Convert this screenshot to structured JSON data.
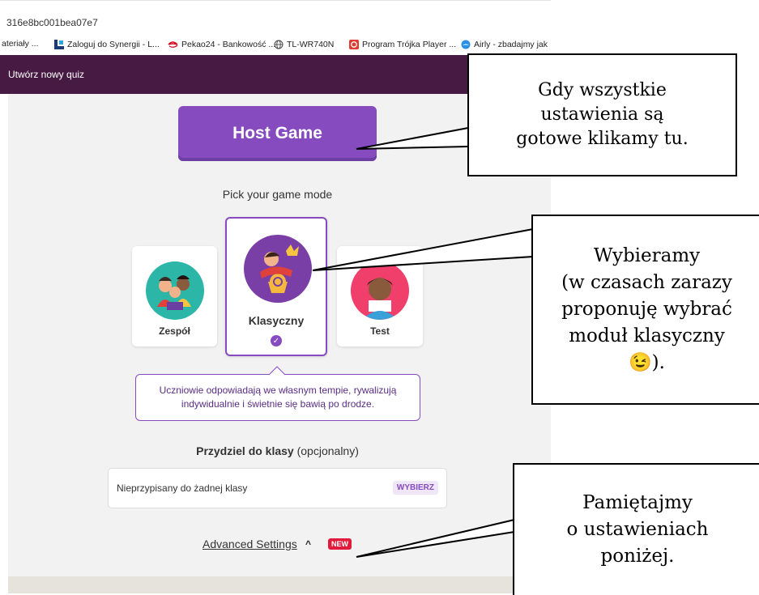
{
  "browser": {
    "url": "316e8bc001bea07e7",
    "bookmarks": [
      {
        "label": "ateriały ...",
        "icon": ""
      },
      {
        "label": "Zaloguj do Synergii - L...",
        "icon": "librus-icon"
      },
      {
        "label": "Pekao24 - Bankowość ...",
        "icon": "pekao-icon"
      },
      {
        "label": "TL-WR740N",
        "icon": "globe-icon"
      },
      {
        "label": "Program Trójka Player ...",
        "icon": "radio-icon"
      },
      {
        "label": "Airly - zbadajmy jak",
        "icon": "airly-icon"
      }
    ]
  },
  "app": {
    "title": "Utwórz nowy quiz"
  },
  "main": {
    "host_button": "Host Game",
    "pick_mode": "Pick your game mode",
    "modes": [
      {
        "label": "Zespół",
        "selected": false
      },
      {
        "label": "Klasyczny",
        "selected": true
      },
      {
        "label": "Test",
        "selected": false
      }
    ],
    "mode_description": {
      "line1": "Uczniowie odpowiadają we własnym tempie, rywalizują",
      "line2": "indywidualnie i świetnie się bawią po drodze."
    },
    "assign": {
      "label": "Przydziel do klasy",
      "optional": "(opcjonalny)"
    },
    "class_select": {
      "value": "Nieprzypisany do żadnej klasy",
      "button": "WYBIERZ"
    },
    "advanced": {
      "label": "Advanced Settings",
      "badge": "NEW"
    }
  },
  "callouts": {
    "host": [
      "Gdy wszystkie",
      "ustawienia są",
      "gotowe klikamy tu."
    ],
    "mode": [
      "Wybieramy",
      "(w czasach zarazy",
      "proponuję wybrać",
      "moduł klasyczny",
      "😉)."
    ],
    "settings": [
      "Pamiętajmy",
      "o ustawieniach",
      "poniżej."
    ]
  },
  "colors": {
    "brand_purple": "#864cbf",
    "appbar": "#461a42",
    "badge_red": "#e21b3c"
  }
}
